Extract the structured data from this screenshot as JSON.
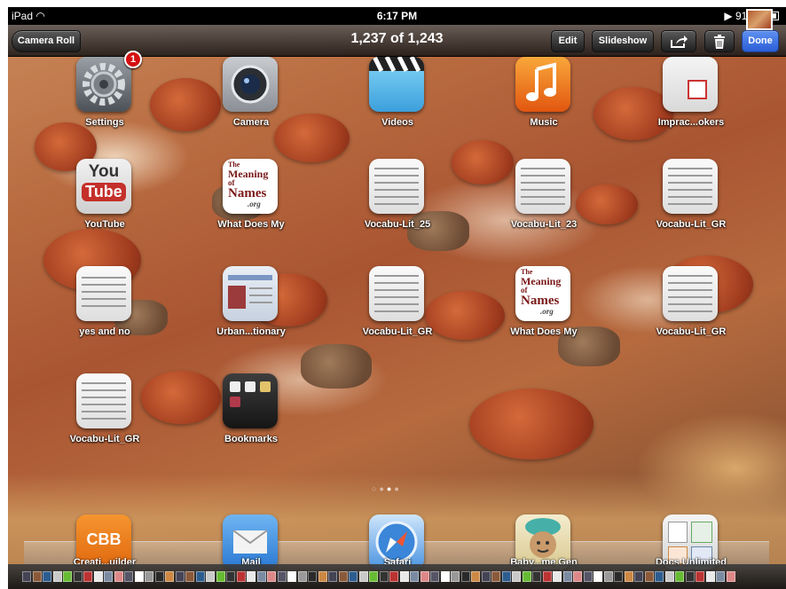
{
  "status": {
    "device": "iPad",
    "time": "6:17 PM",
    "battery": "91%"
  },
  "nav": {
    "back_label": "Camera Roll",
    "title": "1,237 of 1,243",
    "edit_label": "Edit",
    "slideshow_label": "Slideshow",
    "done_label": "Done"
  },
  "icons": {
    "settings_badge": "1",
    "youtube_you": "You",
    "youtube_tube": "Tube",
    "names_line1": "The",
    "names_line2": "Meaning",
    "names_line3": "of",
    "names_line4": "Names",
    "names_line5": ".org",
    "cbb_text": "CBB"
  },
  "apps": [
    {
      "label": "Settings"
    },
    {
      "label": "Camera"
    },
    {
      "label": "Videos"
    },
    {
      "label": "Music"
    },
    {
      "label": "Imprac...okers"
    },
    {
      "label": "YouTube"
    },
    {
      "label": "What Does My"
    },
    {
      "label": "Vocabu-Lit_25"
    },
    {
      "label": "Vocabu-Lit_23"
    },
    {
      "label": "Vocabu-Lit_GR"
    },
    {
      "label": "yes and no"
    },
    {
      "label": "Urban...tionary"
    },
    {
      "label": "Vocabu-Lit_GR"
    },
    {
      "label": "What Does My"
    },
    {
      "label": "Vocabu-Lit_GR"
    },
    {
      "label": "Vocabu-Lit_GR"
    },
    {
      "label": "Bookmarks"
    }
  ],
  "dock": [
    {
      "label": "Creati...uilder"
    },
    {
      "label": "Mail"
    },
    {
      "label": "Safari"
    },
    {
      "label": "Baby...me Gen"
    },
    {
      "label": "Docs Unlimited"
    }
  ],
  "page_dots": {
    "count": 4,
    "current": 3
  },
  "colors": {
    "done": "#2a5fd6",
    "badge": "#d41010",
    "youtube_red": "#c4302b",
    "music_orange": "#f27d1c",
    "cbb_orange": "#f07f1e"
  }
}
